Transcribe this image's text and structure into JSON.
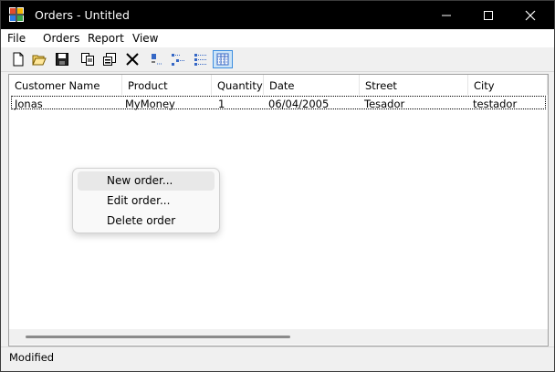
{
  "window": {
    "title": "Orders - Untitled"
  },
  "menu": [
    "File",
    "Orders",
    "Report",
    "View"
  ],
  "toolbar": {
    "icons": [
      "new-icon",
      "open-icon",
      "save-icon",
      "copy-icon",
      "properties-icon",
      "delete-icon",
      "large-icons-icon",
      "small-icons-icon",
      "list-icon",
      "details-icon"
    ],
    "active": "details-icon"
  },
  "columns": [
    "Customer Name",
    "Product",
    "Quantity",
    "Date",
    "Street",
    "City"
  ],
  "rows": [
    [
      "Jonas",
      "MyMoney",
      "1",
      "06/04/2005",
      "Tesador",
      "testador"
    ]
  ],
  "context_menu": {
    "items": [
      "New order...",
      "Edit order...",
      "Delete order"
    ],
    "highlighted": "New order..."
  },
  "status": "Modified"
}
